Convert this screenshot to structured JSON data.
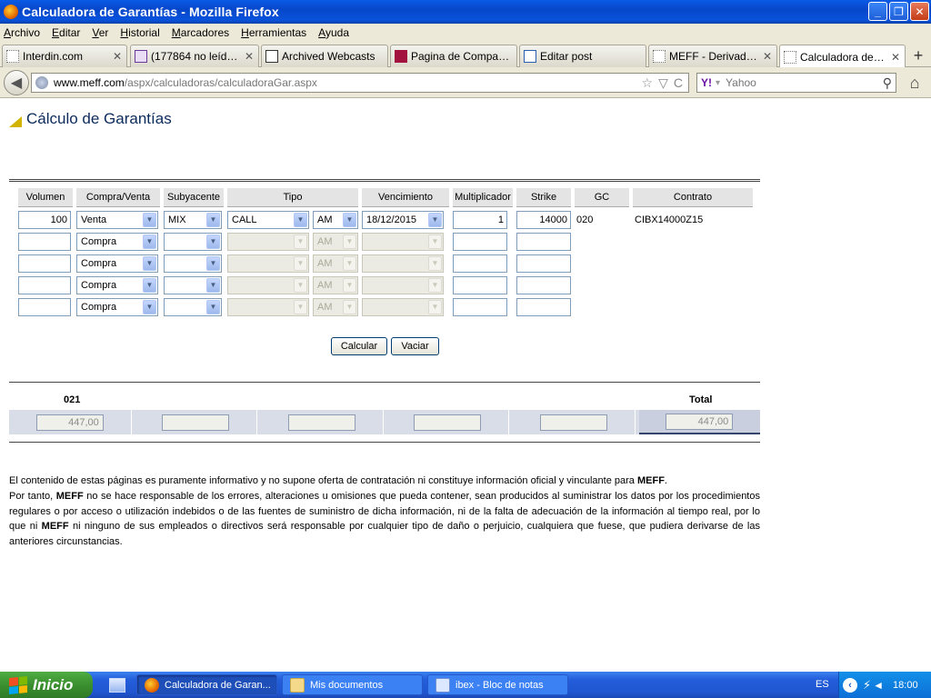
{
  "window": {
    "title": "Calculadora de Garantías - Mozilla Firefox",
    "buttons": {
      "minimize": "_",
      "maximize": "❐",
      "close": "✕"
    }
  },
  "menu": [
    "Archivo",
    "Editar",
    "Ver",
    "Historial",
    "Marcadores",
    "Herramientas",
    "Ayuda"
  ],
  "tabs": [
    {
      "label": "Interdin.com",
      "active": false
    },
    {
      "label": "(177864 no leídos)...",
      "active": false
    },
    {
      "label": "Archived Webcasts",
      "active": false
    },
    {
      "label": "Pagina de Compañ...",
      "active": false
    },
    {
      "label": "Editar post",
      "active": false
    },
    {
      "label": "MEFF - Derivados ...",
      "active": false
    },
    {
      "label": "Calculadora de Ga...",
      "active": true
    }
  ],
  "tab_close": "✕",
  "tab_new": "+",
  "nav": {
    "url_host": "www.meff.com",
    "url_path": "/aspx/calculadoras/calculadoraGar.aspx",
    "search_placeholder": "Yahoo",
    "search_engine": "Y!",
    "back_glyph": "◀",
    "home_glyph": "⌂",
    "search_glyph": "⚲",
    "star_glyph": "☆",
    "dropdown_glyph": "▽",
    "reload_glyph": "C"
  },
  "page": {
    "title": "Cálculo de Garantías",
    "headers": [
      "Volumen",
      "Compra/Venta",
      "Subyacente",
      "Tipo",
      "Vencimiento",
      "Multiplicador",
      "Strike",
      "GC",
      "Contrato"
    ],
    "rows": [
      {
        "volumen": "100",
        "compra_venta": "Venta",
        "subyacente": "MIX",
        "tipo": "CALL",
        "estilo": "AM",
        "vencimiento": "18/12/2015",
        "multiplicador": "1",
        "strike": "14000",
        "gc": "020",
        "contrato": "CIBX14000Z15",
        "disabled": false
      },
      {
        "volumen": "",
        "compra_venta": "Compra",
        "subyacente": "",
        "tipo": "",
        "estilo": "AM",
        "vencimiento": "",
        "multiplicador": "",
        "strike": "",
        "gc": "",
        "contrato": "",
        "disabled": true
      },
      {
        "volumen": "",
        "compra_venta": "Compra",
        "subyacente": "",
        "tipo": "",
        "estilo": "AM",
        "vencimiento": "",
        "multiplicador": "",
        "strike": "",
        "gc": "",
        "contrato": "",
        "disabled": true
      },
      {
        "volumen": "",
        "compra_venta": "Compra",
        "subyacente": "",
        "tipo": "",
        "estilo": "AM",
        "vencimiento": "",
        "multiplicador": "",
        "strike": "",
        "gc": "",
        "contrato": "",
        "disabled": true
      },
      {
        "volumen": "",
        "compra_venta": "Compra",
        "subyacente": "",
        "tipo": "",
        "estilo": "AM",
        "vencimiento": "",
        "multiplicador": "",
        "strike": "",
        "gc": "",
        "contrato": "",
        "disabled": true
      }
    ],
    "buttons": {
      "calcular": "Calcular",
      "vaciar": "Vaciar"
    },
    "results": {
      "group_label": "021",
      "total_label": "Total",
      "values": [
        "447,00",
        "",
        "",
        "",
        "",
        "447,00"
      ]
    },
    "disclaimer_1_pre": "El contenido de estas páginas es puramente informativo y no supone oferta de contratación ni constituye información oficial y vinculante para ",
    "disclaimer_1_brand": "MEFF",
    "disclaimer_1_post": ".",
    "disclaimer_2_a": "Por tanto, ",
    "disclaimer_2_brand1": "MEFF",
    "disclaimer_2_b": " no se hace responsable de los errores, alteraciones u omisiones que pueda contener, sean producidos al suministrar los datos por los procedimientos regulares o por acceso o utilización indebidos o de las fuentes de suministro de dicha información, ni de la falta de adecuación de la información al tiempo real, por lo que ni ",
    "disclaimer_2_brand2": "MEFF",
    "disclaimer_2_c": " ni ninguno de sus empleados o directivos será responsable por cualquier tipo de daño o perjuicio, cualquiera que fuese, que pudiera derivarse de las anteriores circunstancias."
  },
  "taskbar": {
    "start": "Inicio",
    "items": [
      {
        "label": "Calculadora de Garan...",
        "active": true
      },
      {
        "label": "Mis documentos",
        "active": false
      },
      {
        "label": "ibex - Bloc de notas",
        "active": false
      }
    ],
    "lang": "ES",
    "clock": "18:00"
  },
  "colors": {
    "title_text": "#0b2a5b",
    "accent_triangle": "#d2b400",
    "taskbar": "#245edb",
    "start": "#3b8f2f"
  }
}
